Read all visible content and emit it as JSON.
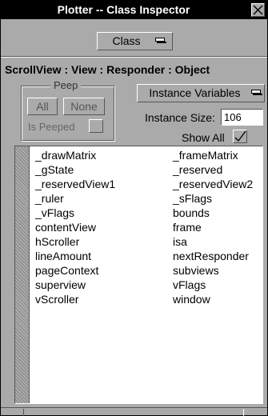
{
  "window": {
    "title": "Plotter -- Class Inspector"
  },
  "class_popup": {
    "label": "Class"
  },
  "hierarchy": "ScrollView : View : Responder : Object",
  "peep": {
    "title": "Peep",
    "all_label": "All",
    "none_label": "None",
    "is_peeped_label": "Is Peeped"
  },
  "ivars_popup": {
    "label": "Instance Variables"
  },
  "instance_size": {
    "label": "Instance Size:",
    "value": "106"
  },
  "show_all": {
    "label": "Show All",
    "checked": true
  },
  "variables": [
    [
      "_drawMatrix",
      "_frameMatrix"
    ],
    [
      "_gState",
      "_reserved"
    ],
    [
      "_reservedView1",
      "_reservedView2"
    ],
    [
      "_ruler",
      "_sFlags"
    ],
    [
      "_vFlags",
      "bounds"
    ],
    [
      "contentView",
      "frame"
    ],
    [
      "hScroller",
      "isa"
    ],
    [
      "lineAmount",
      "nextResponder"
    ],
    [
      "pageContext",
      "subviews"
    ],
    [
      "superview",
      "vFlags"
    ],
    [
      "vScroller",
      "window"
    ]
  ],
  "colors": {
    "window_bg": "#aaaaaa",
    "titlebar_bg": "#000000",
    "list_bg": "#ffffff"
  },
  "icons": {
    "close": "close-icon",
    "popup": "popup-indicator-icon",
    "check": "checkmark-icon"
  }
}
